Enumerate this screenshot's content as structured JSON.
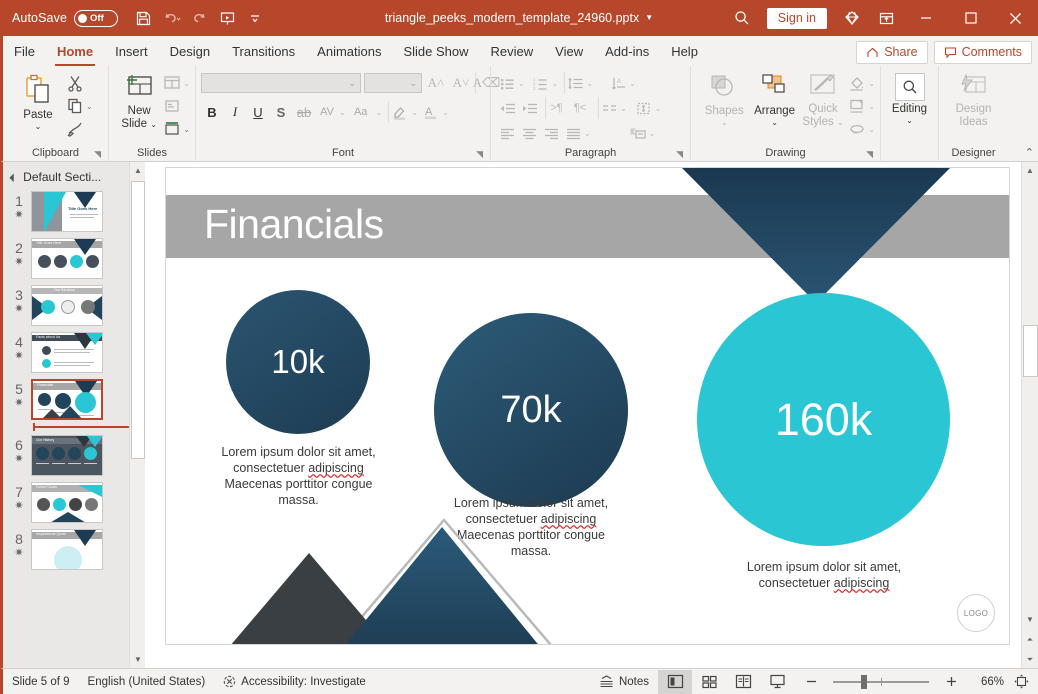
{
  "titlebar": {
    "autosave_label": "AutoSave",
    "autosave_state": "Off",
    "document_title": "triangle_peeks_modern_template_24960.pptx",
    "signin_label": "Sign in",
    "accent_color": "#b7472a"
  },
  "tabs": [
    {
      "label": "File",
      "active": false
    },
    {
      "label": "Home",
      "active": true
    },
    {
      "label": "Insert",
      "active": false
    },
    {
      "label": "Design",
      "active": false
    },
    {
      "label": "Transitions",
      "active": false
    },
    {
      "label": "Animations",
      "active": false
    },
    {
      "label": "Slide Show",
      "active": false
    },
    {
      "label": "Review",
      "active": false
    },
    {
      "label": "View",
      "active": false
    },
    {
      "label": "Add-ins",
      "active": false
    },
    {
      "label": "Help",
      "active": false
    }
  ],
  "tabs_right": {
    "share_label": "Share",
    "comments_label": "Comments"
  },
  "ribbon": {
    "groups": [
      {
        "name": "Clipboard",
        "label": "Clipboard",
        "paste_label": "Paste"
      },
      {
        "name": "Slides",
        "label": "Slides",
        "new_slide_label_1": "New",
        "new_slide_label_2": "Slide"
      },
      {
        "name": "Font",
        "label": "Font"
      },
      {
        "name": "Paragraph",
        "label": "Paragraph"
      },
      {
        "name": "Drawing",
        "label": "Drawing",
        "shapes_label": "Shapes",
        "arrange_label": "Arrange",
        "quick_styles_label_1": "Quick",
        "quick_styles_label_2": "Styles"
      },
      {
        "name": "Editing",
        "label": "",
        "editing_label": "Editing"
      },
      {
        "name": "Designer",
        "label": "Designer",
        "design_ideas_label_1": "Design",
        "design_ideas_label_2": "Ideas"
      }
    ],
    "font_name_value": "",
    "font_size_value": ""
  },
  "thumbnails": {
    "section_label": "Default Secti...",
    "selected_index": 5,
    "slides": [
      {
        "num": "1",
        "title": "Title Goes Here",
        "kind": "title"
      },
      {
        "num": "2",
        "title": "Title Goes Here",
        "kind": "icons4"
      },
      {
        "num": "3",
        "title": "Our Services",
        "kind": "services3"
      },
      {
        "num": "4",
        "title": "Facts about Us",
        "kind": "facts"
      },
      {
        "num": "5",
        "title": "Financials",
        "kind": "financials"
      },
      {
        "num": "6",
        "title": "Our History",
        "kind": "history"
      },
      {
        "num": "7",
        "title": "Future Goals",
        "kind": "goals"
      },
      {
        "num": "8",
        "title": "Inspirational Quote",
        "kind": "quote"
      }
    ]
  },
  "slide": {
    "title": "Financials",
    "logo_label": "LOGO",
    "stats": [
      {
        "value": "10k",
        "caption_before": "Lorem ipsum dolor sit amet, consectetuer ",
        "caption_misspelled": "adipiscing",
        "caption_after": " Maecenas porttitor congue massa.",
        "color": "#24475f"
      },
      {
        "value": "70k",
        "caption_before": "Lorem ipsum dolor sit amet, consectetuer ",
        "caption_misspelled": "adipiscing",
        "caption_after": " Maecenas porttitor congue massa.",
        "color": "#234660"
      },
      {
        "value": "160k",
        "caption_before": "Lorem ipsum dolor sit amet, consectetuer ",
        "caption_misspelled": "adipiscing",
        "caption_after": "",
        "color": "#2ac6d4"
      }
    ]
  },
  "status": {
    "slide_counter": "Slide 5 of 9",
    "language": "English (United States)",
    "accessibility": "Accessibility: Investigate",
    "notes_label": "Notes",
    "zoom_percent": "66%"
  }
}
